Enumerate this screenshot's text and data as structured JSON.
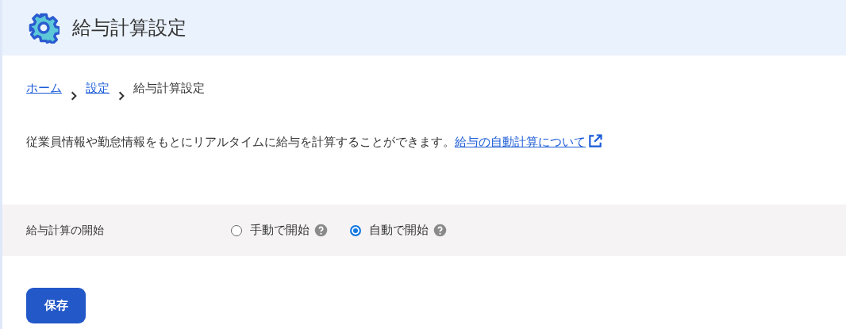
{
  "header": {
    "title": "給与計算設定"
  },
  "breadcrumb": [
    {
      "label": "ホーム",
      "kind": "link"
    },
    {
      "label": "設定",
      "kind": "link"
    },
    {
      "label": "給与計算設定",
      "kind": "current"
    }
  ],
  "description": {
    "text": "従業員情報や勤怠情報をもとにリアルタイムに給与を計算することができます。",
    "link": "給与の自動計算について"
  },
  "setting": {
    "label": "給与計算の開始",
    "options": [
      {
        "label": "手動で開始",
        "selected": false
      },
      {
        "label": "自動で開始",
        "selected": true
      }
    ]
  },
  "save_button": "保存"
}
